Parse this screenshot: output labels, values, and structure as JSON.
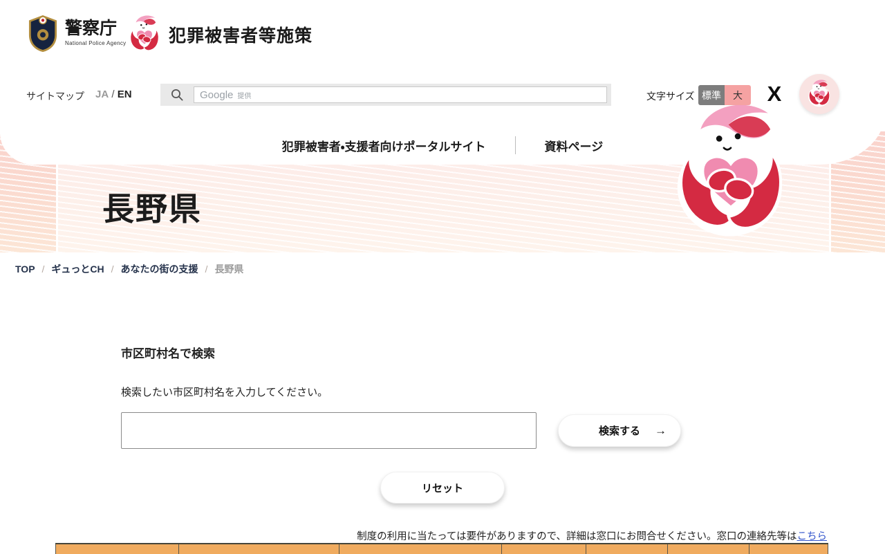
{
  "header": {
    "agency_name": "警察庁",
    "agency_subtitle": "National Police Agency",
    "site_title": "犯罪被害者等施策",
    "sitemap_label": "サイトマップ",
    "lang_ja": "JA",
    "lang_separator": "/",
    "lang_en": "EN",
    "search_watermark_brand": "Google",
    "search_watermark_note": "提供",
    "search_input_value": "",
    "font_size_label": "文字サイズ",
    "font_size_standard": "標準",
    "font_size_large": "大",
    "x_logo_glyph": "X",
    "nav_portal_label": "犯罪被害者・支援者向けポータルサイト",
    "nav_docs_label": "資料ページ"
  },
  "hero": {
    "title": "長野県"
  },
  "breadcrumb": {
    "separator": "/",
    "items": [
      "TOP",
      "ギュっとCH",
      "あなたの街の支援",
      "長野県"
    ]
  },
  "search_section": {
    "heading": "市区町村名で検索",
    "description": "検索したい市区町村名を入力してください。",
    "input_value": "",
    "search_button_label": "検索する",
    "search_button_arrow": "→",
    "reset_button_label": "リセット"
  },
  "notice": {
    "text": "制度の利用に当たっては要件がありますので、詳細は窓口にお問合せください。窓口の連絡先等は",
    "link_label": "こちら"
  },
  "table": {
    "header_column_count": 7
  },
  "icons": {
    "police_emblem": "police-emblem-icon",
    "mascot": "mascot-character-icon",
    "magnifier": "search-icon",
    "x": "x-social-icon"
  },
  "colors": {
    "brand_red": "#d42a42",
    "heart_pink": "#f08bb0",
    "hair_pink": "#f3a0c0",
    "hero_band_pink": "#fad2cc",
    "table_header_orange": "#f0ab5f",
    "font_size_standard_bg": "#7d7d7d",
    "font_size_large_bg": "#f5a2a2",
    "link_blue": "#3355cc"
  }
}
